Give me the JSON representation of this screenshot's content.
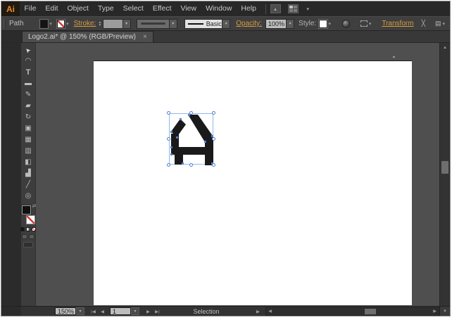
{
  "app": {
    "logo_text": "Ai"
  },
  "menubar": {
    "items": [
      {
        "label": "File",
        "name": "menu-file"
      },
      {
        "label": "Edit",
        "name": "menu-edit"
      },
      {
        "label": "Object",
        "name": "menu-object"
      },
      {
        "label": "Type",
        "name": "menu-type"
      },
      {
        "label": "Select",
        "name": "menu-select"
      },
      {
        "label": "Effect",
        "name": "menu-effect"
      },
      {
        "label": "View",
        "name": "menu-view"
      },
      {
        "label": "Window",
        "name": "menu-window"
      },
      {
        "label": "Help",
        "name": "menu-help"
      }
    ],
    "icons": [
      "bridge-icon",
      "workspace-switcher-icon"
    ]
  },
  "controlbar": {
    "object_type": "Path",
    "stroke_label": "Stroke:",
    "brush_value": "Basic",
    "opacity_label": "Opacity:",
    "opacity_value": "100%",
    "style_label": "Style:",
    "transform_label": "Transform",
    "icons": [
      "fill-swatch",
      "stroke-none-swatch",
      "recolor-artwork-icon",
      "select-similar-icon",
      "isolate-icon",
      "arrange-icon"
    ]
  },
  "tab": {
    "title": "Logo2.ai* @ 150% (RGB/Preview)",
    "close_label": "×"
  },
  "tools": [
    {
      "name": "selection-tool",
      "glyph": "➤"
    },
    {
      "name": "lasso-tool",
      "glyph": "◠"
    },
    {
      "name": "type-tool",
      "glyph": "T"
    },
    {
      "name": "rectangle-tool",
      "glyph": "▬"
    },
    {
      "name": "paintbrush-tool",
      "glyph": "✎"
    },
    {
      "name": "eraser-tool",
      "glyph": "▰"
    },
    {
      "name": "rotate-tool",
      "glyph": "↻"
    },
    {
      "name": "free-transform-tool",
      "glyph": "▣"
    },
    {
      "name": "mesh-tool",
      "glyph": "▦"
    },
    {
      "name": "gradient-tool",
      "glyph": "▥"
    },
    {
      "name": "shape-builder-tool",
      "glyph": "◧"
    },
    {
      "name": "column-graph-tool",
      "glyph": "▟"
    },
    {
      "name": "slice-tool",
      "glyph": "╱"
    },
    {
      "name": "zoom-tool",
      "glyph": "◎"
    }
  ],
  "statusbar": {
    "zoom_value": "150%",
    "first_label": "|◀",
    "prev_label": "◀",
    "artboard_value": "1",
    "next_label": "▶",
    "last_label": "▶|",
    "status_text": "Selection",
    "expand_label": "▶"
  },
  "scrollbars": {
    "up": "▲",
    "down": "▼",
    "left": "◀",
    "right": "▶"
  },
  "ui": {
    "chevron": "▾",
    "swap_icon": "⇄",
    "spin_up": "▲",
    "spin_down": "▼"
  },
  "colors": {
    "logo_orange": "#F6891F",
    "accent_orange": "#D79C3F",
    "selection_blue": "#4A7FD6",
    "artwork_black": "#1A1A1A",
    "none_red": "#D93A3A",
    "canvas_gray": "#4F4F4F",
    "panel_gray": "#3F3F3F",
    "artboard_white": "#FFFFFF"
  }
}
